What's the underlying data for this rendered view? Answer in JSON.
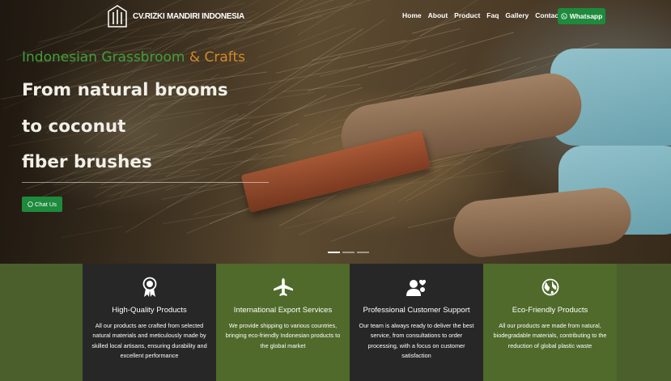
{
  "brand": {
    "name": "CV.RIZKI MANDIRI INDONESIA",
    "icon": "broom-logo-icon"
  },
  "nav": {
    "items": [
      {
        "label": "Home"
      },
      {
        "label": "About"
      },
      {
        "label": "Product"
      },
      {
        "label": "Faq"
      },
      {
        "label": "Gallery"
      },
      {
        "label": "Contact"
      }
    ],
    "whatsapp_label": "Whatsapp"
  },
  "hero": {
    "eyebrow_green": "Indonesian Grassbroom",
    "eyebrow_amp_orange": "& Crafts",
    "headline_lines": [
      "From natural brooms",
      "to coconut",
      "fiber brushes"
    ],
    "chat_label": "Chat Us",
    "slides_total": 3,
    "active_slide": 1
  },
  "features": [
    {
      "icon": "award-ribbon-icon",
      "title": "High-Quality Products",
      "description": "All our products are crafted from selected natural materials and meticulously made by skilled local artisans, ensuring durability and excellent performance"
    },
    {
      "icon": "airplane-icon",
      "title": "International Export Services",
      "description": "We provide shipping to various countries, bringing eco-friendly Indonesian products to the global market"
    },
    {
      "icon": "people-heart-icon",
      "title": "Professional Customer Support",
      "description": "Our team is always ready to deliver the best service, from consultations to order processing, with a focus on customer satisfaction"
    },
    {
      "icon": "globe-icon",
      "title": "Eco-Friendly Products",
      "description": "All our products are made from natural, biodegradable materials, contributing to the reduction of global plastic waste"
    }
  ],
  "colors": {
    "accent_green": "#1e8a3c",
    "section_green": "#4a5f2c",
    "eyebrow_green": "#3f9e3a",
    "eyebrow_orange": "#d2892a",
    "card_dark": "#272727"
  }
}
